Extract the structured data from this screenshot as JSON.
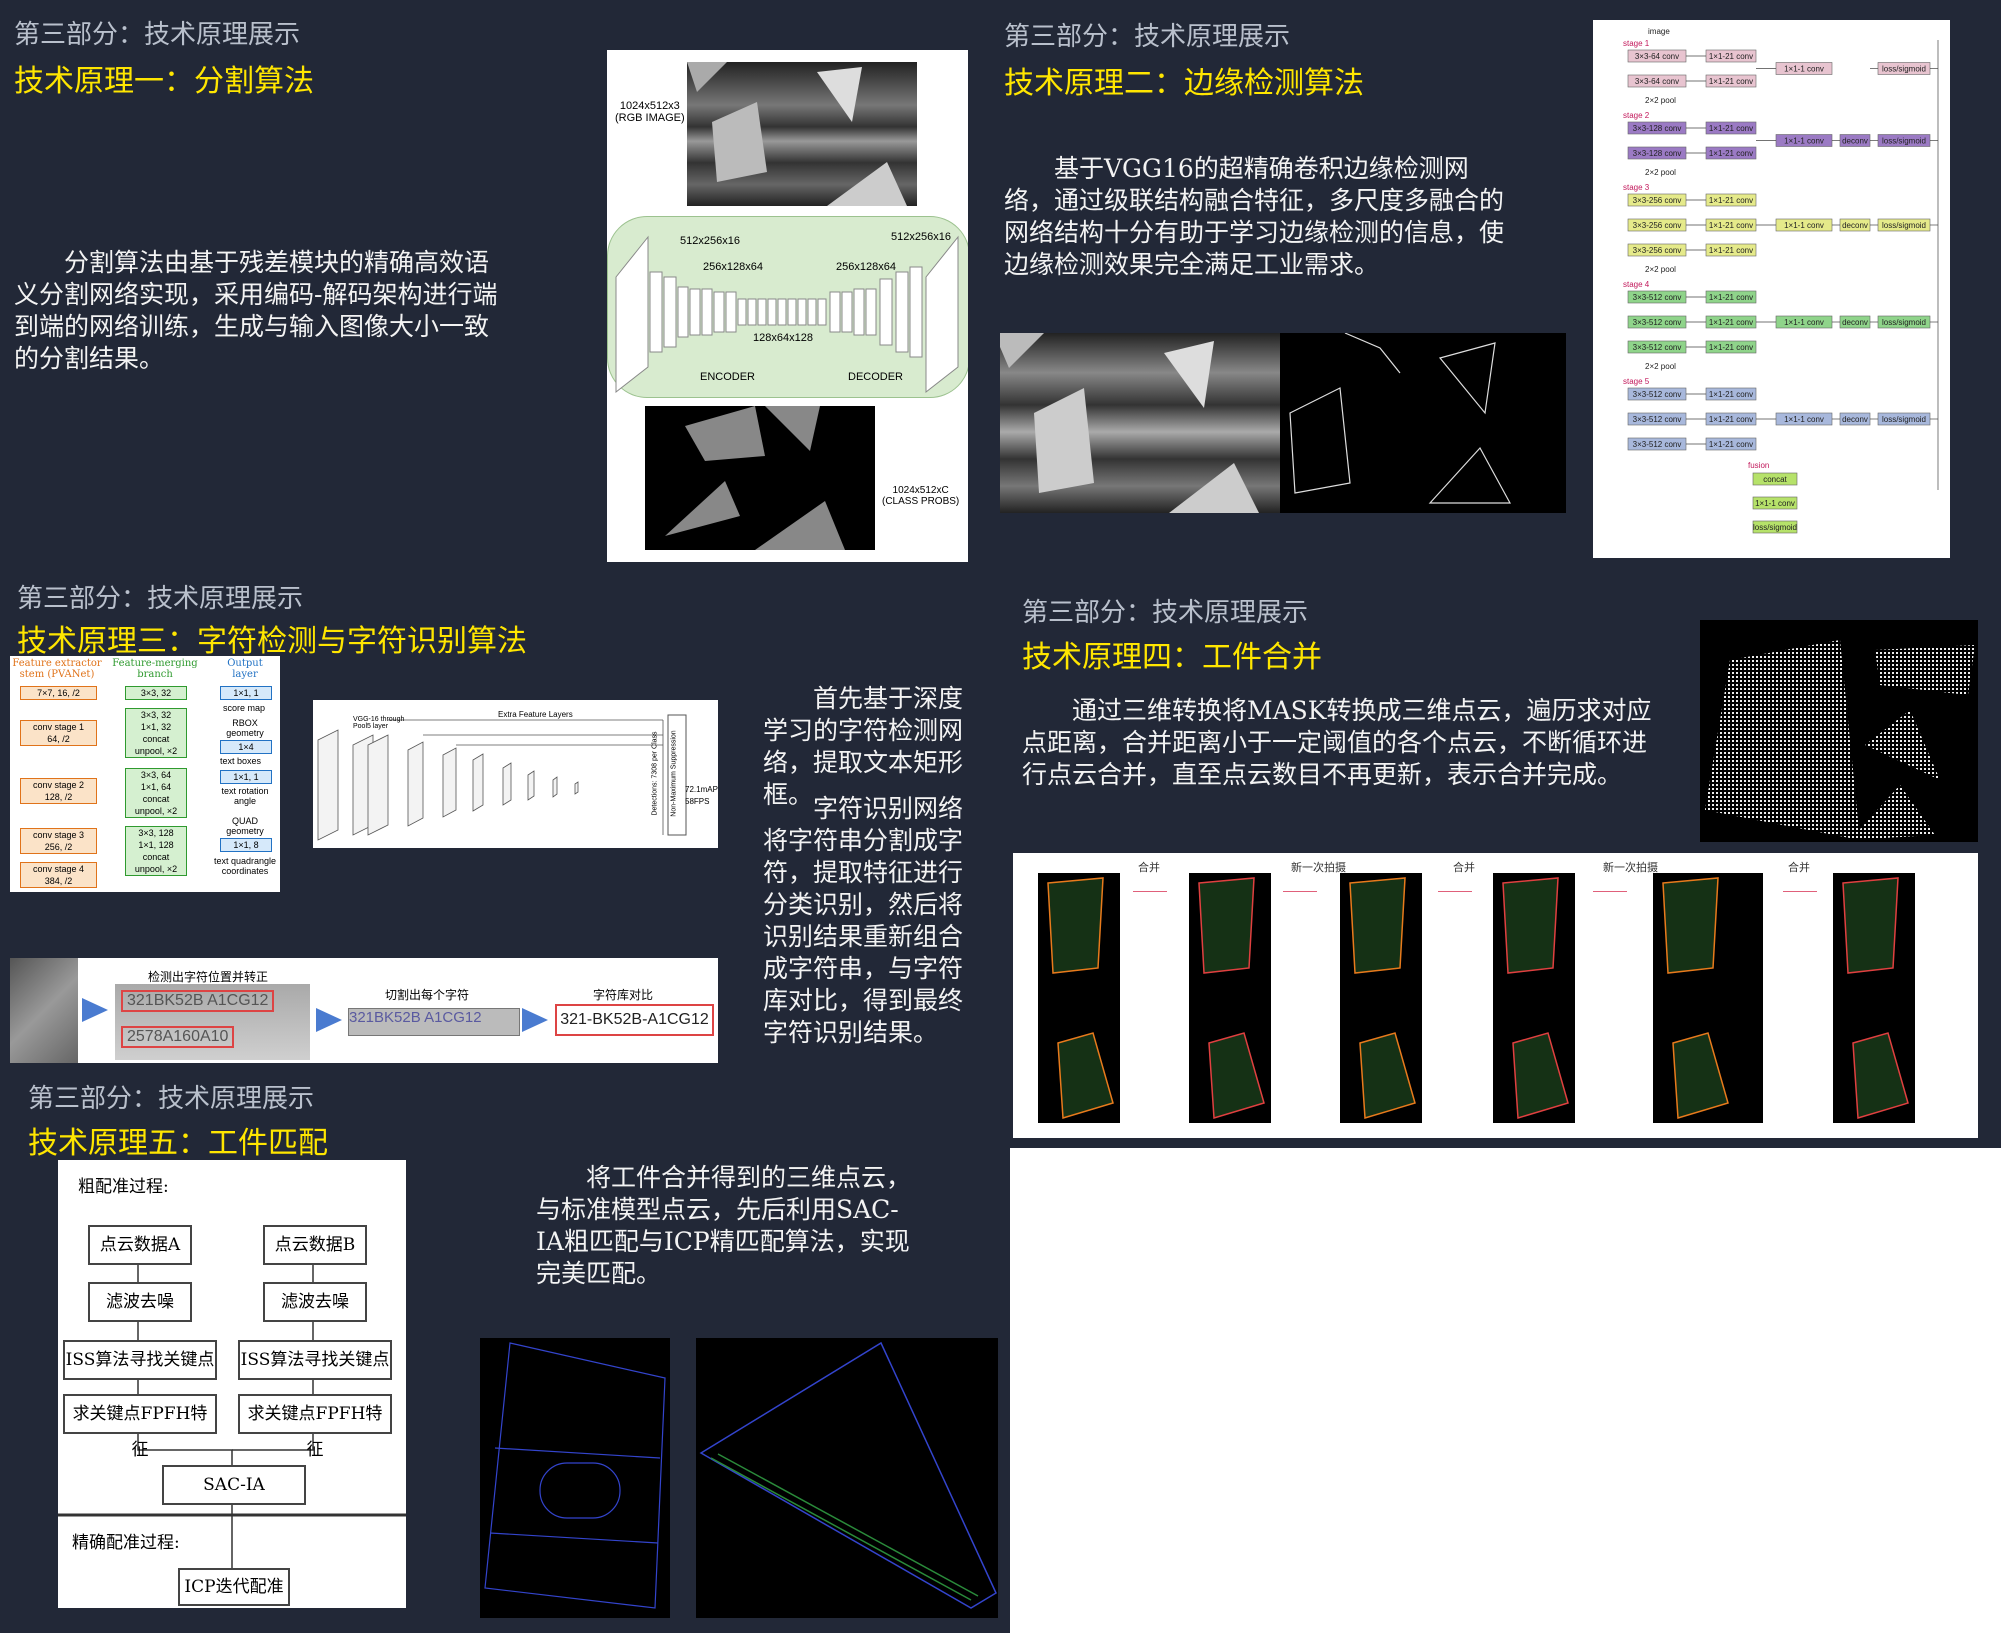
{
  "section_label": "第三部分：技术原理展示",
  "p1": {
    "title": "技术原理一：分割算法",
    "body": "分割算法由基于残差模块的精确高效语义分割网络实现，采用编码-解码架构进行端到端的网络训练，生成与输入图像大小一致的分割结果。",
    "fig": {
      "input_label": "1024x512x3\n(RGB IMAGE)",
      "dim1": "512x256x16",
      "dim2": "256x128x64",
      "dim3": "256x128x64",
      "dim4": "512x256x16",
      "dim_mid": "128x64x128",
      "encoder": "ENCODER",
      "decoder": "DECODER",
      "output_label": "1024x512xC\n(CLASS PROBS)"
    }
  },
  "p2": {
    "title": "技术原理二：边缘检测算法",
    "body": "基于VGG16的超精确卷积边缘检测网络，通过级联结构融合特征，多尺度多融合的网络结构十分有助于学习边缘检测的信息，使边缘检测效果完全满足工业需求。",
    "net": {
      "image": "image",
      "pool": "2×2 pool",
      "fusion": "fusion",
      "stages": [
        {
          "name": "stage 1",
          "convs": [
            "3×3-64 conv",
            "3×3-64 conv"
          ],
          "color": "#e8c4d0"
        },
        {
          "name": "stage 2",
          "convs": [
            "3×3-128 conv",
            "3×3-128 conv"
          ],
          "color": "#9b7ac4"
        },
        {
          "name": "stage 3",
          "convs": [
            "3×3-256 conv",
            "3×3-256 conv",
            "3×3-256 conv"
          ],
          "color": "#e5ea8a"
        },
        {
          "name": "stage 4",
          "convs": [
            "3×3-512 conv",
            "3×3-512 conv",
            "3×3-512 conv"
          ],
          "color": "#8fd48a"
        },
        {
          "name": "stage 5",
          "convs": [
            "3×3-512 conv",
            "3×3-512 conv",
            "3×3-512 conv"
          ],
          "color": "#a8b8dc"
        }
      ],
      "side_conv": "1×1-21 conv",
      "one_conv": "1×1-1 conv",
      "deconv": "deconv",
      "loss": "loss/sigmoid",
      "concat": "concat"
    }
  },
  "p3": {
    "title": "技术原理三：字符检测与字符识别算法",
    "body1": "首先基于深度学习的字符检测网络，提取文本矩形框。",
    "body2": "字符识别网络将字符串分割成字符，提取特征进行分类识别，然后将识别结果重新组合成字符串，与字符库对比，得到最终字符识别结果。",
    "east": {
      "head1": "Feature extractor stem (PVANet)",
      "head2": "Feature-merging branch",
      "head3": "Output layer",
      "stem": [
        "7×7, 16, /2",
        "conv stage 1\n64, /2",
        "conv stage 2\n128, /2",
        "conv stage 3\n256, /2",
        "conv stage 4\n384, /2"
      ],
      "merge": [
        "3×3, 32",
        "3×3, 32\n1×1, 32\nconcat\nunpool, ×2",
        "3×3, 64\n1×1, 64\nconcat\nunpool, ×2",
        "3×3, 128\n1×1, 128\nconcat\nunpool, ×2"
      ],
      "out": [
        "1×1, 1",
        "score map",
        "RBOX geometry",
        "1×4",
        "text boxes",
        "1×1, 1",
        "text rotation angle",
        "QUAD geometry",
        "1×1, 8",
        "text quadrangle coordinates"
      ]
    },
    "ssd": {
      "title": "Extra Feature Layers",
      "vgg": "VGG-16 through Pool5 layer",
      "nms": "Non-Maximum Suppression",
      "det": "Detections: 7308 per Class",
      "map": "72.1mAP",
      "fps": "58FPS"
    },
    "ocr": {
      "step1": "检测出字符位置并转正",
      "step2": "切割出每个字符",
      "step3": "字符库对比",
      "line1": "321BK52B A1CG12",
      "line2": "2578A160A10",
      "result": "321-BK52B-A1CG12"
    }
  },
  "p4": {
    "title": "技术原理四：工件合并",
    "body": "通过三维转换将MASK转换成三维点云，遍历求对应点距离，合并距离小于一定阈值的各个点云，不断循环进行点云合并，直至点云数目不再更新，表示合并完成。",
    "steps": [
      "合并",
      "新一次拍摄",
      "合并",
      "新一次拍摄",
      "合并"
    ]
  },
  "p5": {
    "title": "技术原理五：工件匹配",
    "body": "将工件合并得到的三维点云，与标准模型点云，先后利用SAC-IA粗匹配与ICP精匹配算法，实现完美匹配。",
    "flow": {
      "coarse": "粗配准过程:",
      "fine": "精确配准过程:",
      "a": "点云数据A",
      "b": "点云数据B",
      "filter": "滤波去噪",
      "iss": "ISS算法寻找关键点",
      "fpfh": "求关键点FPFH特征",
      "sac": "SAC-IA",
      "icp": "ICP迭代配准"
    }
  },
  "colors": {
    "panel": "#222837",
    "title": "#ffe600",
    "section": "#b9c0cc",
    "text": "#f3f3f3"
  }
}
